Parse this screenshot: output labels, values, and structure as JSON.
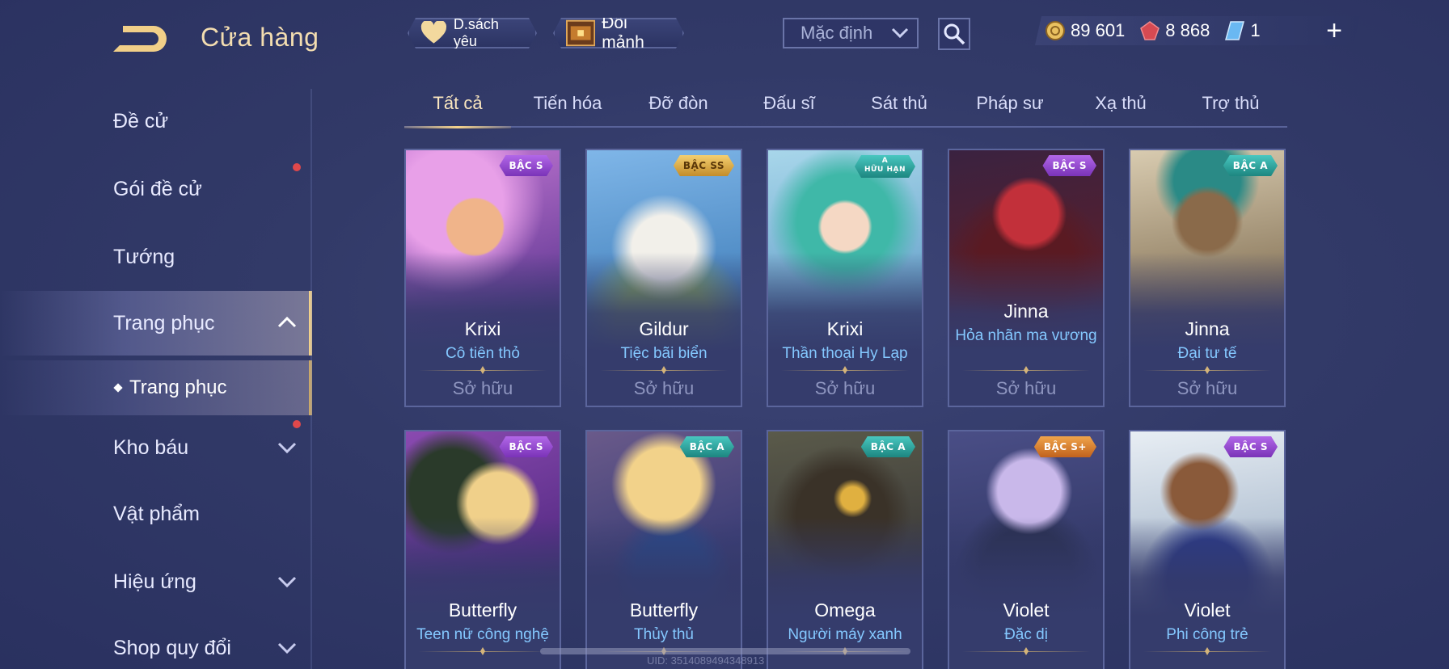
{
  "header": {
    "title": "Cửa hàng",
    "favorites_label": "D.sách yêu",
    "exchange_label": "Đổi mảnh",
    "sort_selected": "Mặc định",
    "currencies": [
      {
        "name": "gold-coin",
        "value": "89 601"
      },
      {
        "name": "red-gem",
        "value": "8 868"
      },
      {
        "name": "blue-voucher",
        "value": "1"
      }
    ]
  },
  "sidebar": {
    "items": [
      {
        "label": "Đề cử"
      },
      {
        "label": "Gói đề cử"
      },
      {
        "label": "Tướng"
      },
      {
        "label": "Trang phục"
      },
      {
        "label": "Kho báu"
      },
      {
        "label": "Vật phẩm"
      },
      {
        "label": "Hiệu ứng"
      },
      {
        "label": "Shop quy đổi"
      }
    ],
    "sub_item": "Trang phục"
  },
  "tabs": [
    "Tất cả",
    "Tiến hóa",
    "Đỡ đòn",
    "Đấu sĩ",
    "Sát thủ",
    "Pháp sư",
    "Xạ thủ",
    "Trợ thủ"
  ],
  "cards": [
    {
      "hero": "Krixi",
      "skin": "Cô tiên thỏ",
      "badge": "BẬC S",
      "status": "Sở hữu"
    },
    {
      "hero": "Gildur",
      "skin": "Tiệc bãi biển",
      "badge": "BẬC SS",
      "status": "Sở hữu"
    },
    {
      "hero": "Krixi",
      "skin": "Thần thoại Hy Lạp",
      "badge": "A",
      "badge_sub": "HỮU HẠN",
      "status": "Sở hữu"
    },
    {
      "hero": "Jinna",
      "skin": "Hỏa nhãn ma vương",
      "badge": "BẬC S",
      "status": "Sở hữu"
    },
    {
      "hero": "Jinna",
      "skin": "Đại tư tế",
      "badge": "BẬC A",
      "status": "Sở hữu"
    },
    {
      "hero": "Butterfly",
      "skin": "Teen nữ công nghệ",
      "badge": "BẬC S"
    },
    {
      "hero": "Butterfly",
      "skin": "Thủy thủ",
      "badge": "BẬC A"
    },
    {
      "hero": "Omega",
      "skin": "Người máy xanh",
      "badge": "BẬC A"
    },
    {
      "hero": "Violet",
      "skin": "Đặc dị",
      "badge": "BẬC S+"
    },
    {
      "hero": "Violet",
      "skin": "Phi công trẻ",
      "badge": "BẬC S"
    }
  ],
  "uid_text": "UID: 3514089494348913",
  "colors": {
    "accent_gold": "#f3ddb0",
    "skin_name_blue": "#84c8ff",
    "background": "#323a68"
  }
}
